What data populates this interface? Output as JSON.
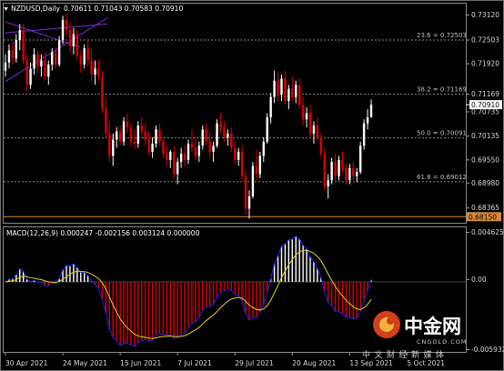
{
  "header": {
    "symbol_label": "NZDUSD,Daily",
    "ohlc_label": "0.70611 0.71043 0.70583 0.70910"
  },
  "macd_header": {
    "label": "MACD(12,26,9) 0.000247 -0.002156 0.003124 0.000000"
  },
  "price_axis": {
    "labels": [
      "0.73120",
      "0.72503",
      "0.71920",
      "0.71169",
      "0.70735",
      "0.70135",
      "0.69550",
      "0.68980",
      "0.68365"
    ],
    "current_price": "0.70910",
    "horizontal_level": "0.68150"
  },
  "fib_levels": [
    {
      "label": "23.6 = 0.72503",
      "price": 0.72503
    },
    {
      "label": "38.2 = 0.71169",
      "price": 0.71169
    },
    {
      "label": "50.0 = 0.70091",
      "price": 0.70091
    },
    {
      "label": "61.8 = 0.69012",
      "price": 0.69012
    }
  ],
  "macd_axis": {
    "labels": [
      "0.004625",
      "0.00",
      "-0.005932"
    ]
  },
  "time_axis": {
    "labels": [
      "30 Apr 2021",
      "24 May 2021",
      "15 Jun 2021",
      "7 Jul 2021",
      "29 Jul 2021",
      "20 Aug 2021",
      "13 Sep 2021",
      "5 Oct 2021"
    ]
  },
  "watermark": {
    "brand_cn": "中金网",
    "domain": "CNGOLD.COM",
    "tagline": "中文财经新媒体"
  },
  "colors": {
    "background": "#000000",
    "bull_candle": "#ffffff",
    "bear_candle": "#dd0000",
    "trendline": "#7b2fd6",
    "horizontal_level": "#d9883a",
    "macd_histogram": "#ffffff",
    "macd_signal": "#e8d21a",
    "macd_line": "#2222ee"
  },
  "chart_data": {
    "type": "candlestick",
    "symbol": "NZDUSD",
    "timeframe": "Daily",
    "ylim": [
      0.68,
      0.734
    ],
    "x_tick_labels": [
      "30 Apr 2021",
      "24 May 2021",
      "15 Jun 2021",
      "7 Jul 2021",
      "29 Jul 2021",
      "20 Aug 2021",
      "13 Sep 2021",
      "5 Oct 2021"
    ],
    "x_tick_bar_index": [
      0,
      16,
      32,
      48,
      64,
      80,
      96,
      112
    ],
    "candles": [
      {
        "o": 0.7175,
        "h": 0.7215,
        "l": 0.716,
        "c": 0.7195
      },
      {
        "o": 0.7195,
        "h": 0.724,
        "l": 0.718,
        "c": 0.7225
      },
      {
        "o": 0.7225,
        "h": 0.7245,
        "l": 0.719,
        "c": 0.7205
      },
      {
        "o": 0.7205,
        "h": 0.7265,
        "l": 0.7195,
        "c": 0.725
      },
      {
        "o": 0.725,
        "h": 0.729,
        "l": 0.7225,
        "c": 0.7275
      },
      {
        "o": 0.7275,
        "h": 0.729,
        "l": 0.719,
        "c": 0.72
      },
      {
        "o": 0.72,
        "h": 0.7215,
        "l": 0.7125,
        "c": 0.714
      },
      {
        "o": 0.714,
        "h": 0.7195,
        "l": 0.713,
        "c": 0.718
      },
      {
        "o": 0.718,
        "h": 0.723,
        "l": 0.7165,
        "c": 0.7215
      },
      {
        "o": 0.7215,
        "h": 0.7225,
        "l": 0.717,
        "c": 0.7185
      },
      {
        "o": 0.7185,
        "h": 0.7215,
        "l": 0.716,
        "c": 0.72
      },
      {
        "o": 0.72,
        "h": 0.722,
        "l": 0.715,
        "c": 0.716
      },
      {
        "o": 0.716,
        "h": 0.72,
        "l": 0.714,
        "c": 0.719
      },
      {
        "o": 0.719,
        "h": 0.723,
        "l": 0.7175,
        "c": 0.722
      },
      {
        "o": 0.722,
        "h": 0.723,
        "l": 0.718,
        "c": 0.719
      },
      {
        "o": 0.719,
        "h": 0.726,
        "l": 0.7185,
        "c": 0.725
      },
      {
        "o": 0.725,
        "h": 0.731,
        "l": 0.724,
        "c": 0.73
      },
      {
        "o": 0.73,
        "h": 0.7315,
        "l": 0.726,
        "c": 0.7275
      },
      {
        "o": 0.7275,
        "h": 0.7295,
        "l": 0.722,
        "c": 0.7235
      },
      {
        "o": 0.7235,
        "h": 0.728,
        "l": 0.7215,
        "c": 0.7265
      },
      {
        "o": 0.7265,
        "h": 0.7275,
        "l": 0.72,
        "c": 0.721
      },
      {
        "o": 0.721,
        "h": 0.7225,
        "l": 0.717,
        "c": 0.719
      },
      {
        "o": 0.719,
        "h": 0.724,
        "l": 0.718,
        "c": 0.723
      },
      {
        "o": 0.723,
        "h": 0.725,
        "l": 0.7185,
        "c": 0.72
      },
      {
        "o": 0.72,
        "h": 0.723,
        "l": 0.715,
        "c": 0.7165
      },
      {
        "o": 0.7165,
        "h": 0.72,
        "l": 0.714,
        "c": 0.718
      },
      {
        "o": 0.718,
        "h": 0.72,
        "l": 0.715,
        "c": 0.716
      },
      {
        "o": 0.716,
        "h": 0.7175,
        "l": 0.707,
        "c": 0.708
      },
      {
        "o": 0.708,
        "h": 0.711,
        "l": 0.701,
        "c": 0.702
      },
      {
        "o": 0.702,
        "h": 0.705,
        "l": 0.695,
        "c": 0.6965
      },
      {
        "o": 0.6965,
        "h": 0.702,
        "l": 0.694,
        "c": 0.7005
      },
      {
        "o": 0.7005,
        "h": 0.7035,
        "l": 0.6985,
        "c": 0.7025
      },
      {
        "o": 0.7025,
        "h": 0.704,
        "l": 0.699,
        "c": 0.7
      },
      {
        "o": 0.7,
        "h": 0.706,
        "l": 0.699,
        "c": 0.705
      },
      {
        "o": 0.705,
        "h": 0.707,
        "l": 0.702,
        "c": 0.7035
      },
      {
        "o": 0.7035,
        "h": 0.7045,
        "l": 0.699,
        "c": 0.7
      },
      {
        "o": 0.7,
        "h": 0.703,
        "l": 0.698,
        "c": 0.6995
      },
      {
        "o": 0.6995,
        "h": 0.705,
        "l": 0.6985,
        "c": 0.704
      },
      {
        "o": 0.704,
        "h": 0.706,
        "l": 0.701,
        "c": 0.7025
      },
      {
        "o": 0.7025,
        "h": 0.7045,
        "l": 0.699,
        "c": 0.7005
      },
      {
        "o": 0.7005,
        "h": 0.7025,
        "l": 0.6965,
        "c": 0.6975
      },
      {
        "o": 0.6975,
        "h": 0.701,
        "l": 0.696,
        "c": 0.6995
      },
      {
        "o": 0.6995,
        "h": 0.704,
        "l": 0.6985,
        "c": 0.703
      },
      {
        "o": 0.703,
        "h": 0.7045,
        "l": 0.699,
        "c": 0.7
      },
      {
        "o": 0.7,
        "h": 0.701,
        "l": 0.696,
        "c": 0.697
      },
      {
        "o": 0.697,
        "h": 0.699,
        "l": 0.694,
        "c": 0.6955
      },
      {
        "o": 0.6955,
        "h": 0.698,
        "l": 0.6935,
        "c": 0.6975
      },
      {
        "o": 0.6975,
        "h": 0.699,
        "l": 0.691,
        "c": 0.692
      },
      {
        "o": 0.692,
        "h": 0.696,
        "l": 0.6895,
        "c": 0.695
      },
      {
        "o": 0.695,
        "h": 0.6985,
        "l": 0.6935,
        "c": 0.697
      },
      {
        "o": 0.697,
        "h": 0.699,
        "l": 0.694,
        "c": 0.6955
      },
      {
        "o": 0.6955,
        "h": 0.7005,
        "l": 0.6945,
        "c": 0.6995
      },
      {
        "o": 0.6995,
        "h": 0.703,
        "l": 0.6975,
        "c": 0.6985
      },
      {
        "o": 0.6985,
        "h": 0.701,
        "l": 0.6955,
        "c": 0.6965
      },
      {
        "o": 0.6965,
        "h": 0.7,
        "l": 0.695,
        "c": 0.699
      },
      {
        "o": 0.699,
        "h": 0.704,
        "l": 0.698,
        "c": 0.703
      },
      {
        "o": 0.703,
        "h": 0.7045,
        "l": 0.699,
        "c": 0.7
      },
      {
        "o": 0.7,
        "h": 0.7025,
        "l": 0.696,
        "c": 0.6975
      },
      {
        "o": 0.6975,
        "h": 0.7,
        "l": 0.695,
        "c": 0.699
      },
      {
        "o": 0.699,
        "h": 0.7055,
        "l": 0.6985,
        "c": 0.7045
      },
      {
        "o": 0.7045,
        "h": 0.707,
        "l": 0.702,
        "c": 0.7035
      },
      {
        "o": 0.7035,
        "h": 0.705,
        "l": 0.7,
        "c": 0.701
      },
      {
        "o": 0.701,
        "h": 0.703,
        "l": 0.699,
        "c": 0.702
      },
      {
        "o": 0.702,
        "h": 0.7035,
        "l": 0.6975,
        "c": 0.6985
      },
      {
        "o": 0.6985,
        "h": 0.7,
        "l": 0.6945,
        "c": 0.6955
      },
      {
        "o": 0.6955,
        "h": 0.6985,
        "l": 0.694,
        "c": 0.6975
      },
      {
        "o": 0.6975,
        "h": 0.699,
        "l": 0.6905,
        "c": 0.6915
      },
      {
        "o": 0.6915,
        "h": 0.693,
        "l": 0.682,
        "c": 0.6835
      },
      {
        "o": 0.6835,
        "h": 0.688,
        "l": 0.681,
        "c": 0.6865
      },
      {
        "o": 0.6865,
        "h": 0.695,
        "l": 0.686,
        "c": 0.694
      },
      {
        "o": 0.694,
        "h": 0.698,
        "l": 0.6905,
        "c": 0.692
      },
      {
        "o": 0.692,
        "h": 0.6975,
        "l": 0.691,
        "c": 0.6965
      },
      {
        "o": 0.6965,
        "h": 0.701,
        "l": 0.695,
        "c": 0.7
      },
      {
        "o": 0.7,
        "h": 0.707,
        "l": 0.6995,
        "c": 0.706
      },
      {
        "o": 0.706,
        "h": 0.712,
        "l": 0.7045,
        "c": 0.711
      },
      {
        "o": 0.711,
        "h": 0.7175,
        "l": 0.7095,
        "c": 0.715
      },
      {
        "o": 0.715,
        "h": 0.717,
        "l": 0.71,
        "c": 0.7115
      },
      {
        "o": 0.7115,
        "h": 0.7165,
        "l": 0.71,
        "c": 0.7155
      },
      {
        "o": 0.7155,
        "h": 0.7175,
        "l": 0.709,
        "c": 0.71
      },
      {
        "o": 0.71,
        "h": 0.714,
        "l": 0.708,
        "c": 0.713
      },
      {
        "o": 0.713,
        "h": 0.716,
        "l": 0.71,
        "c": 0.711
      },
      {
        "o": 0.711,
        "h": 0.715,
        "l": 0.7095,
        "c": 0.714
      },
      {
        "o": 0.714,
        "h": 0.7155,
        "l": 0.708,
        "c": 0.709
      },
      {
        "o": 0.709,
        "h": 0.711,
        "l": 0.704,
        "c": 0.7055
      },
      {
        "o": 0.7055,
        "h": 0.7085,
        "l": 0.7035,
        "c": 0.707
      },
      {
        "o": 0.707,
        "h": 0.709,
        "l": 0.701,
        "c": 0.702
      },
      {
        "o": 0.702,
        "h": 0.705,
        "l": 0.6995,
        "c": 0.704
      },
      {
        "o": 0.704,
        "h": 0.706,
        "l": 0.7,
        "c": 0.701
      },
      {
        "o": 0.701,
        "h": 0.702,
        "l": 0.696,
        "c": 0.697
      },
      {
        "o": 0.697,
        "h": 0.6985,
        "l": 0.688,
        "c": 0.689
      },
      {
        "o": 0.689,
        "h": 0.692,
        "l": 0.686,
        "c": 0.6905
      },
      {
        "o": 0.6905,
        "h": 0.696,
        "l": 0.6895,
        "c": 0.695
      },
      {
        "o": 0.695,
        "h": 0.697,
        "l": 0.6905,
        "c": 0.6915
      },
      {
        "o": 0.6915,
        "h": 0.6965,
        "l": 0.6905,
        "c": 0.6955
      },
      {
        "o": 0.6955,
        "h": 0.6975,
        "l": 0.6925,
        "c": 0.6935
      },
      {
        "o": 0.6935,
        "h": 0.6945,
        "l": 0.6895,
        "c": 0.6905
      },
      {
        "o": 0.6905,
        "h": 0.6945,
        "l": 0.6895,
        "c": 0.6935
      },
      {
        "o": 0.6935,
        "h": 0.695,
        "l": 0.6905,
        "c": 0.6915
      },
      {
        "o": 0.6915,
        "h": 0.6935,
        "l": 0.69,
        "c": 0.6925
      },
      {
        "o": 0.6925,
        "h": 0.7,
        "l": 0.692,
        "c": 0.699
      },
      {
        "o": 0.699,
        "h": 0.7055,
        "l": 0.698,
        "c": 0.7045
      },
      {
        "o": 0.7045,
        "h": 0.708,
        "l": 0.703,
        "c": 0.706
      },
      {
        "o": 0.7061,
        "h": 0.7104,
        "l": 0.7058,
        "c": 0.7091
      }
    ]
  }
}
